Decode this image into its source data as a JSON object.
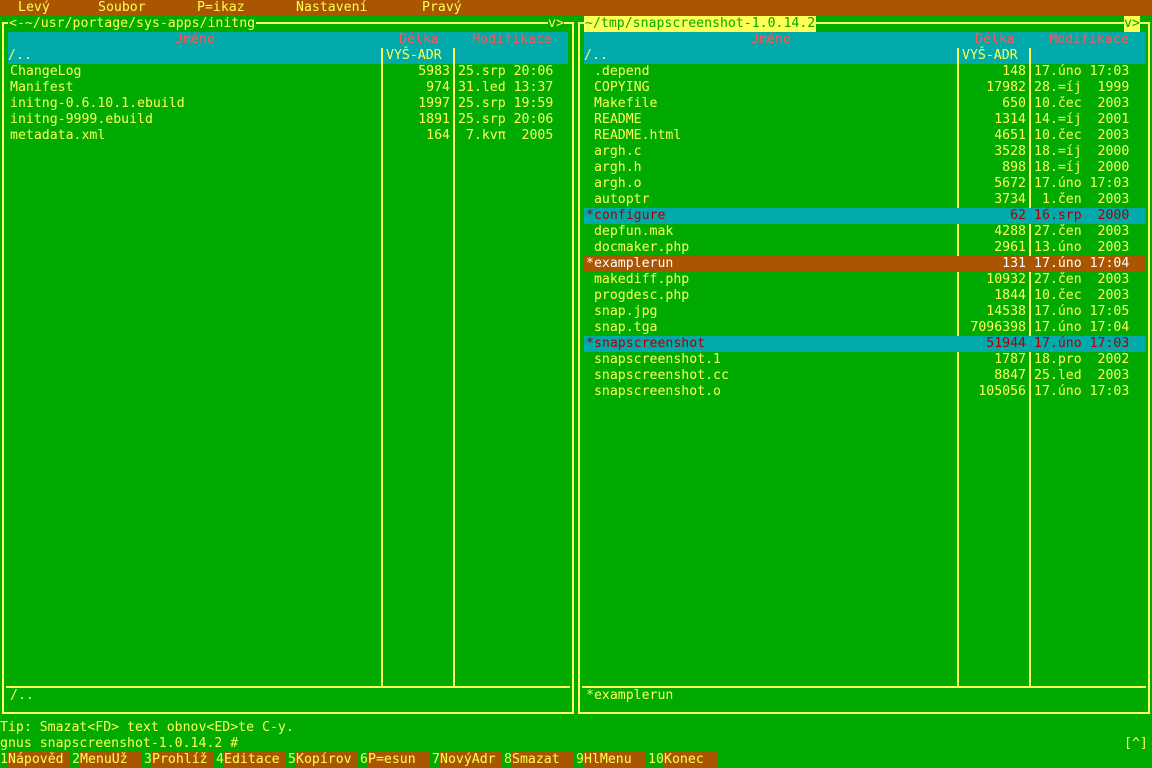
{
  "menu": [
    {
      "label": "Levý"
    },
    {
      "label": "Soubor"
    },
    {
      "label": "Příkaz",
      "display": "P=ikaz"
    },
    {
      "label": "Nastavení"
    },
    {
      "label": "Pravý"
    }
  ],
  "left_panel": {
    "path": "<-~/usr/portage/sys-apps/initng",
    "corner": "v>",
    "headers": {
      "name": "Jméno",
      "size": "Délka",
      "modified": "Modifikace"
    },
    "up_dir": "/..",
    "up_label": "VYŠ-ADR",
    "files": [
      {
        "name": "ChangeLog",
        "size": "5983",
        "date": "25.srp 20:06"
      },
      {
        "name": "Manifest",
        "size": "974",
        "date": "31.led 13:37"
      },
      {
        "name": "initng-0.6.10.1.ebuild",
        "size": "1997",
        "date": "25.srp 19:59"
      },
      {
        "name": "initng-9999.ebuild",
        "size": "1891",
        "date": "25.srp 20:06"
      },
      {
        "name": "metadata.xml",
        "size": "164",
        "date": " 7.kvπ  2005"
      }
    ],
    "status": "/.."
  },
  "right_panel": {
    "path": "~/tmp/snapscreenshot-1.0.14.2",
    "corner": "v>",
    "headers": {
      "name": "Jméno",
      "size": "Délka",
      "modified": "Modifikace"
    },
    "up_dir": "/..",
    "up_label": "VYŠ-ADR",
    "files": [
      {
        "name": " .depend",
        "size": "148",
        "date": "17.úno 17:03",
        "state": ""
      },
      {
        "name": " COPYING",
        "size": "17982",
        "date": "28.=íj  1999",
        "state": ""
      },
      {
        "name": " Makefile",
        "size": "650",
        "date": "10.čec  2003",
        "state": ""
      },
      {
        "name": " README",
        "size": "1314",
        "date": "14.=íj  2001",
        "state": ""
      },
      {
        "name": " README.html",
        "size": "4651",
        "date": "10.čec  2003",
        "state": ""
      },
      {
        "name": " argh.c",
        "size": "3528",
        "date": "18.=íj  2000",
        "state": ""
      },
      {
        "name": " argh.h",
        "size": "898",
        "date": "18.=íj  2000",
        "state": ""
      },
      {
        "name": " argh.o",
        "size": "5672",
        "date": "17.úno 17:03",
        "state": ""
      },
      {
        "name": " autoptr",
        "size": "3734",
        "date": " 1.čen  2003",
        "state": ""
      },
      {
        "name": "*configure",
        "size": "62",
        "date": "16.srp  2000",
        "state": "sel"
      },
      {
        "name": " depfun.mak",
        "size": "4288",
        "date": "27.čen  2003",
        "state": ""
      },
      {
        "name": " docmaker.php",
        "size": "2961",
        "date": "13.úno  2003",
        "state": ""
      },
      {
        "name": "*examplerun",
        "size": "131",
        "date": "17.úno 17:04",
        "state": "cursor"
      },
      {
        "name": " makediff.php",
        "size": "10932",
        "date": "27.čen  2003",
        "state": ""
      },
      {
        "name": " progdesc.php",
        "size": "1844",
        "date": "10.čec  2003",
        "state": ""
      },
      {
        "name": " snap.jpg",
        "size": "14538",
        "date": "17.úno 17:05",
        "state": ""
      },
      {
        "name": " snap.tga",
        "size": "7096398",
        "date": "17.úno 17:04",
        "state": ""
      },
      {
        "name": "*snapscreenshot",
        "size": "51944",
        "date": "17.úno 17:03",
        "state": "sel"
      },
      {
        "name": " snapscreenshot.1",
        "size": "1787",
        "date": "18.pro  2002",
        "state": ""
      },
      {
        "name": " snapscreenshot.cc",
        "size": "8847",
        "date": "25.led  2003",
        "state": ""
      },
      {
        "name": " snapscreenshot.o",
        "size": "105056",
        "date": "17.úno 17:03",
        "state": ""
      }
    ],
    "status": "*examplerun"
  },
  "tip": "Tip: Smazat<FD> text obnov<ED>te C-y.",
  "prompt": "gnus snapscreenshot-1.0.14.2 #",
  "caret_button": "[^]",
  "fkeys": [
    {
      "num": "1",
      "label": "Nápověd"
    },
    {
      "num": "2",
      "label": "MenuUž"
    },
    {
      "num": "3",
      "label": "Prohlíž"
    },
    {
      "num": "4",
      "label": "Editace"
    },
    {
      "num": "5",
      "label": "Kopírov"
    },
    {
      "num": "6",
      "label": "Přesun",
      "display": "P=esun"
    },
    {
      "num": "7",
      "label": "NovýAdr"
    },
    {
      "num": "8",
      "label": "Smazat"
    },
    {
      "num": "9",
      "label": "HlMenu"
    },
    {
      "num": "10",
      "label": "Konec"
    }
  ],
  "colors": {
    "bg": "#00aa00",
    "menu": "#aa5500",
    "header": "#00aaaa",
    "text": "#ffff55",
    "accent": "#ff5555",
    "selected": "#aa0000"
  }
}
